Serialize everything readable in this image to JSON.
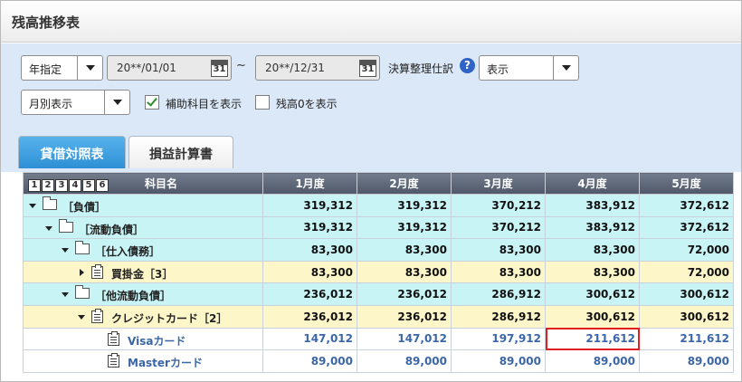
{
  "window": {
    "title": "残高推移表"
  },
  "filters": {
    "period_mode": "年指定",
    "date_from": "20**/01/01",
    "date_to": "20**/12/31",
    "calendar_day": "31",
    "range_separator": "~",
    "closing_entry_label": "決算整理仕訳",
    "closing_entry_value": "表示",
    "display_unit": "月別表示",
    "show_sub_accounts_label": "補助科目を表示",
    "show_sub_accounts_checked": true,
    "show_zero_balance_label": "残高0を表示",
    "show_zero_balance_checked": false
  },
  "tabs": [
    {
      "label": "貸借対照表",
      "active": true
    },
    {
      "label": "損益計算書",
      "active": false
    }
  ],
  "table": {
    "level_buttons": [
      "1",
      "2",
      "3",
      "4",
      "5",
      "6"
    ],
    "columns": [
      "科目名",
      "1月度",
      "2月度",
      "3月度",
      "4月度",
      "5月度"
    ],
    "rows": [
      {
        "name": "［負債］",
        "level": 0,
        "icon": "folder-icon",
        "expander": "down",
        "style": "cyan",
        "values": [
          "319,312",
          "319,312",
          "370,212",
          "383,912",
          "372,612"
        ]
      },
      {
        "name": "［流動負債］",
        "level": 1,
        "icon": "folder-icon",
        "expander": "down",
        "style": "cyan",
        "values": [
          "319,312",
          "319,312",
          "370,212",
          "383,912",
          "372,612"
        ]
      },
      {
        "name": "［仕入債務］",
        "level": 2,
        "icon": "folder-icon",
        "expander": "down",
        "style": "cyan",
        "values": [
          "83,300",
          "83,300",
          "83,300",
          "83,300",
          "72,000"
        ]
      },
      {
        "name": "買掛金［3］",
        "level": 3,
        "icon": "doc-icon",
        "expander": "right",
        "style": "yellow",
        "values": [
          "83,300",
          "83,300",
          "83,300",
          "83,300",
          "72,000"
        ]
      },
      {
        "name": "［他流動負債］",
        "level": 2,
        "icon": "folder-icon",
        "expander": "down",
        "style": "cyan",
        "values": [
          "236,012",
          "236,012",
          "286,912",
          "300,612",
          "300,612"
        ]
      },
      {
        "name": "クレジットカード［2］",
        "level": 3,
        "icon": "doc-icon",
        "expander": "down",
        "style": "yellow",
        "values": [
          "236,012",
          "236,012",
          "286,912",
          "300,612",
          "300,612"
        ]
      },
      {
        "name": "Visaカード",
        "level": 4,
        "icon": "doc-icon",
        "expander": "none",
        "style": "white",
        "values": [
          "147,012",
          "147,012",
          "197,912",
          "211,612",
          "211,612"
        ],
        "highlight": 3
      },
      {
        "name": "Masterカード",
        "level": 4,
        "icon": "doc-icon",
        "expander": "none",
        "style": "white",
        "values": [
          "89,000",
          "89,000",
          "89,000",
          "89,000",
          "89,000"
        ]
      }
    ]
  }
}
